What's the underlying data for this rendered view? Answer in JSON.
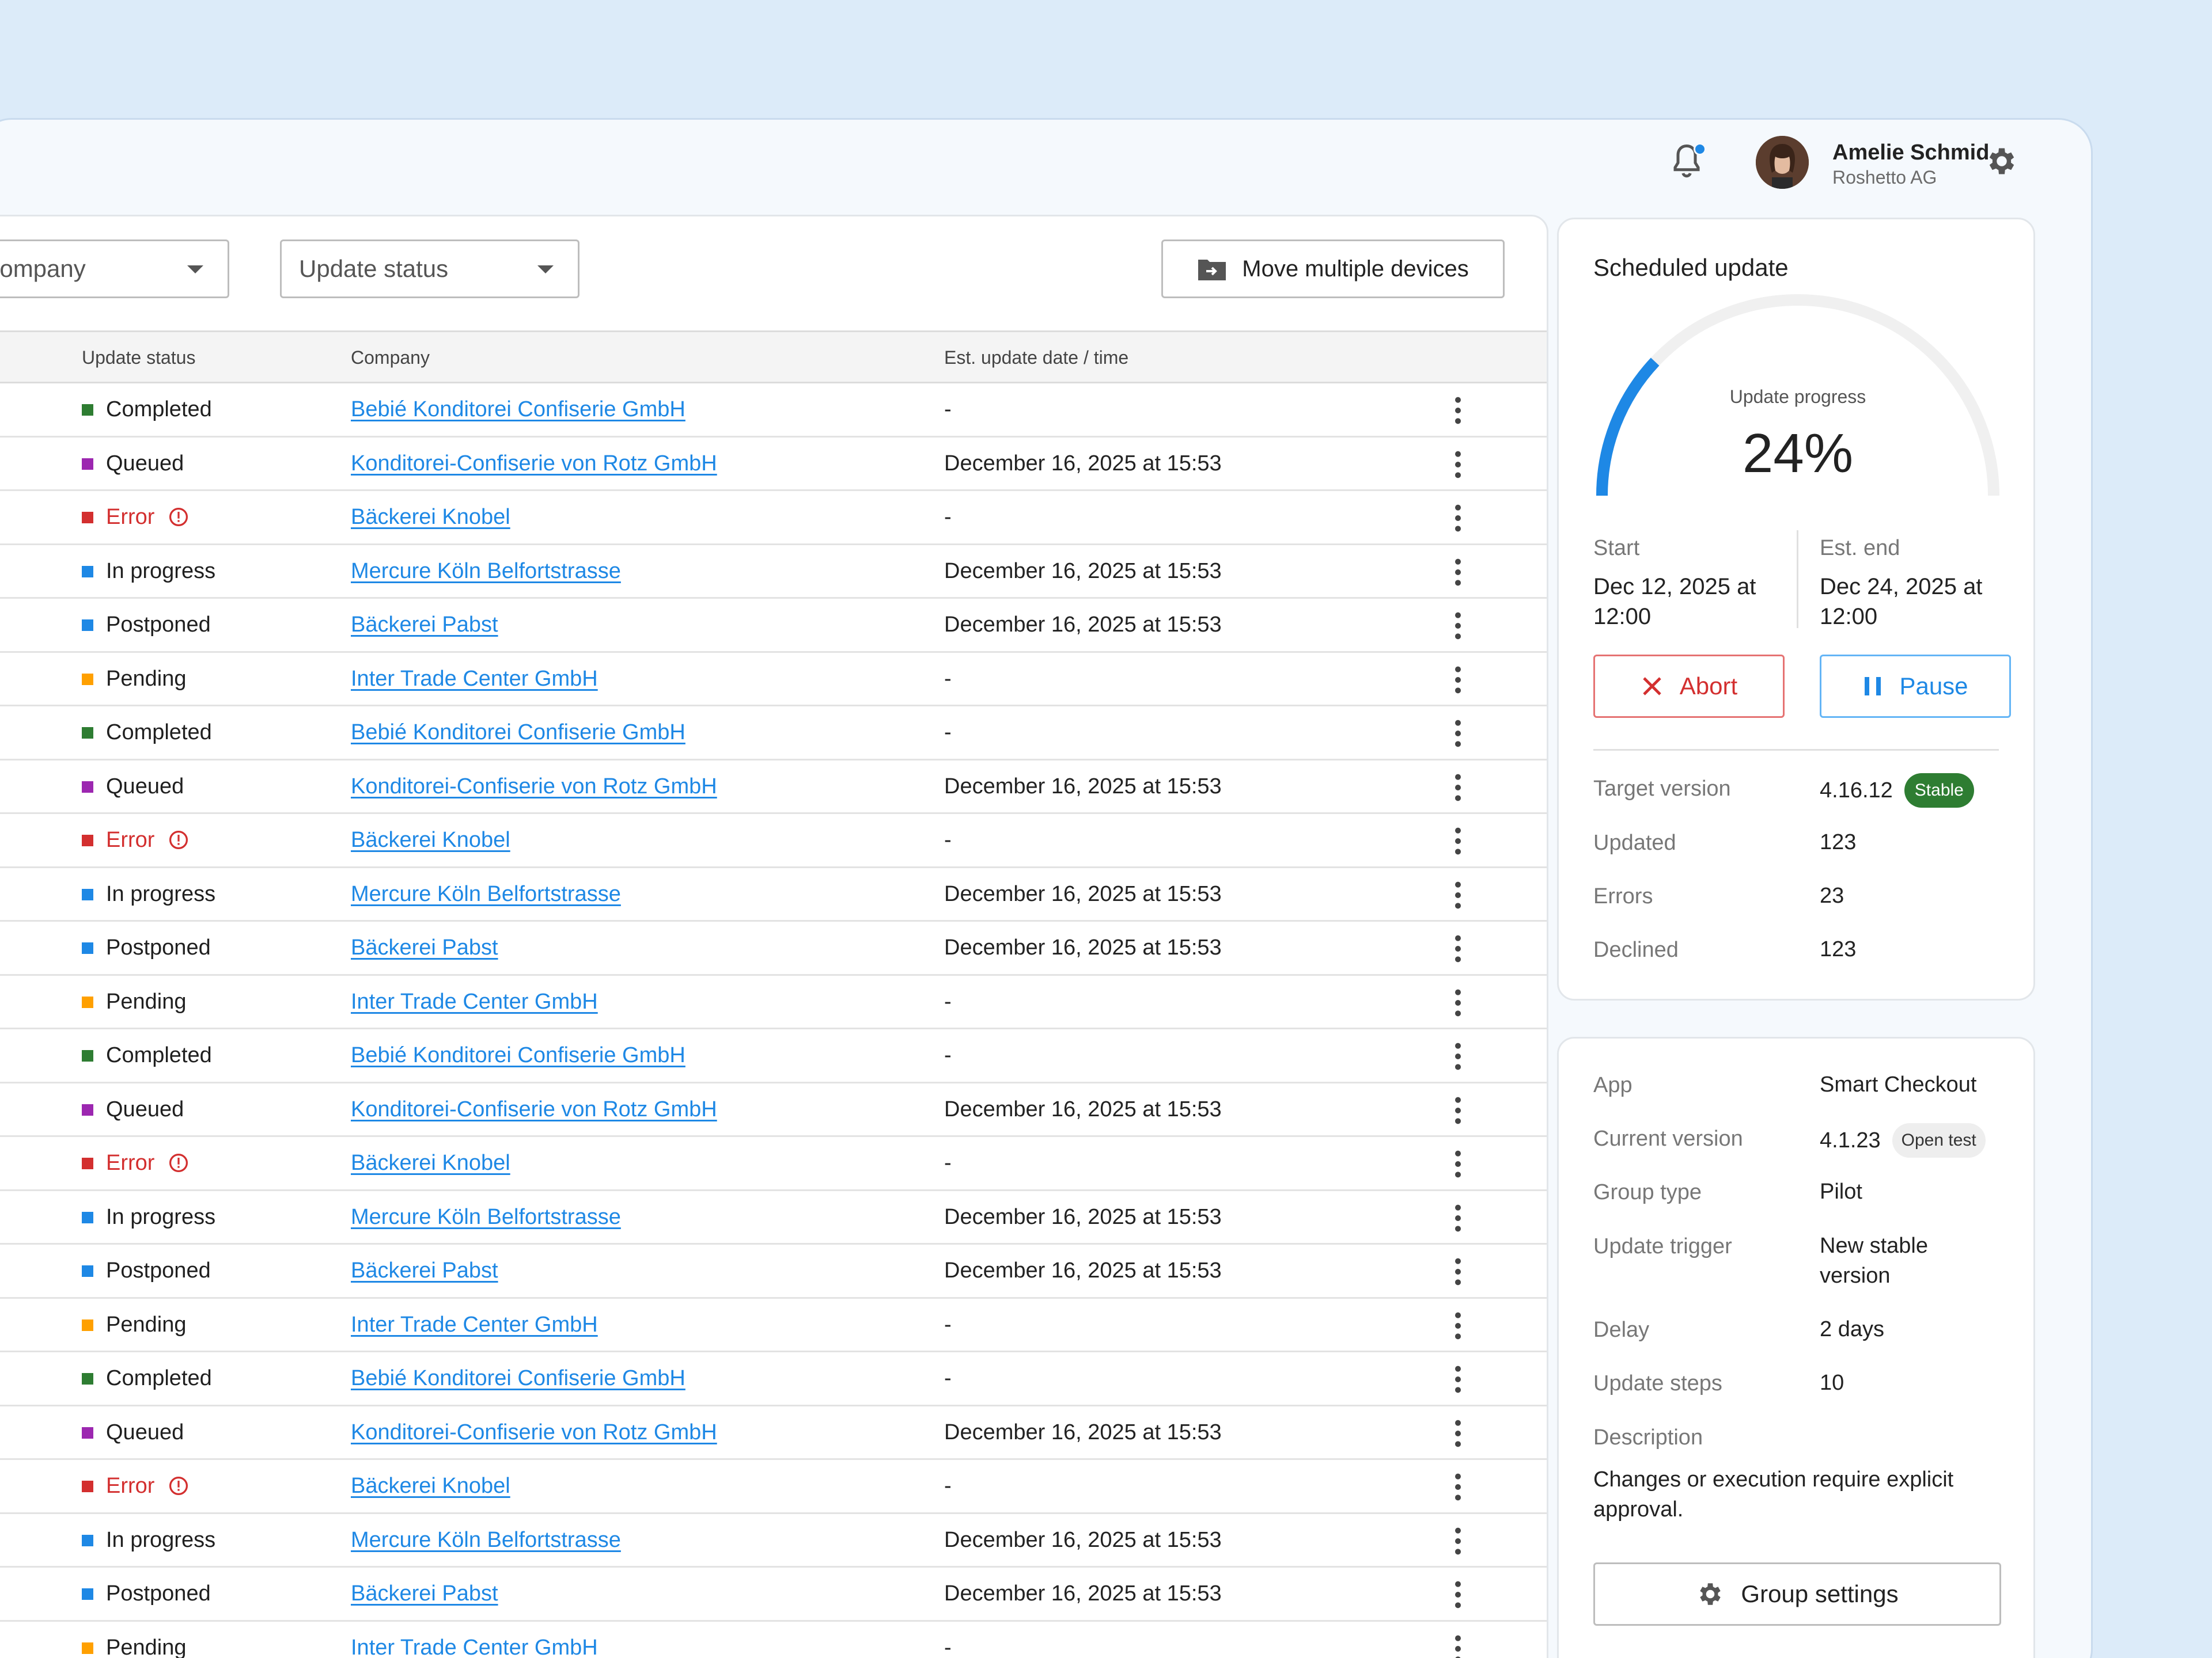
{
  "user": {
    "name": "Amelie Schmid",
    "org": "Roshetto AG"
  },
  "filters": {
    "company": "Company",
    "update_status": "Update status"
  },
  "toolbar": {
    "move_label": "Move multiple devices"
  },
  "table": {
    "headers": {
      "status": "Update status",
      "company": "Company",
      "date": "Est. update date / time"
    },
    "rows": [
      {
        "status": "Completed",
        "company": "Bebié Konditorei Confiserie GmbH",
        "date": "-"
      },
      {
        "status": "Queued",
        "company": "Konditorei-Confiserie von Rotz GmbH",
        "date": "December 16, 2025 at 15:53"
      },
      {
        "status": "Error",
        "company": "Bäckerei Knobel",
        "date": "-"
      },
      {
        "status": "In progress",
        "company": "Mercure Köln Belfortstrasse",
        "date": "December 16, 2025 at 15:53"
      },
      {
        "status": "Postponed",
        "company": "Bäckerei Pabst",
        "date": "December 16, 2025 at 15:53"
      },
      {
        "status": "Pending",
        "company": "Inter Trade Center GmbH",
        "date": "-"
      },
      {
        "status": "Completed",
        "company": "Bebié Konditorei Confiserie GmbH",
        "date": "-"
      },
      {
        "status": "Queued",
        "company": "Konditorei-Confiserie von Rotz GmbH",
        "date": "December 16, 2025 at 15:53"
      },
      {
        "status": "Error",
        "company": "Bäckerei Knobel",
        "date": "-"
      },
      {
        "status": "In progress",
        "company": "Mercure Köln Belfortstrasse",
        "date": "December 16, 2025 at 15:53"
      },
      {
        "status": "Postponed",
        "company": "Bäckerei Pabst",
        "date": "December 16, 2025 at 15:53"
      },
      {
        "status": "Pending",
        "company": "Inter Trade Center GmbH",
        "date": "-"
      },
      {
        "status": "Completed",
        "company": "Bebié Konditorei Confiserie GmbH",
        "date": "-"
      },
      {
        "status": "Queued",
        "company": "Konditorei-Confiserie von Rotz GmbH",
        "date": "December 16, 2025 at 15:53"
      },
      {
        "status": "Error",
        "company": "Bäckerei Knobel",
        "date": "-"
      },
      {
        "status": "In progress",
        "company": "Mercure Köln Belfortstrasse",
        "date": "December 16, 2025 at 15:53"
      },
      {
        "status": "Postponed",
        "company": "Bäckerei Pabst",
        "date": "December 16, 2025 at 15:53"
      },
      {
        "status": "Pending",
        "company": "Inter Trade Center GmbH",
        "date": "-"
      },
      {
        "status": "Completed",
        "company": "Bebié Konditorei Confiserie GmbH",
        "date": "-"
      },
      {
        "status": "Queued",
        "company": "Konditorei-Confiserie von Rotz GmbH",
        "date": "December 16, 2025 at 15:53"
      },
      {
        "status": "Error",
        "company": "Bäckerei Knobel",
        "date": "-"
      },
      {
        "status": "In progress",
        "company": "Mercure Köln Belfortstrasse",
        "date": "December 16, 2025 at 15:53"
      },
      {
        "status": "Postponed",
        "company": "Bäckerei Pabst",
        "date": "December 16, 2025 at 15:53"
      },
      {
        "status": "Pending",
        "company": "Inter Trade Center GmbH",
        "date": "-"
      }
    ]
  },
  "status_colors": {
    "Completed": "#2e7d32",
    "Queued": "#9c27b0",
    "Error": "#d32f2f",
    "In progress": "#1e88e5",
    "Postponed": "#1e88e5",
    "Pending": "#ffa000"
  },
  "scheduled": {
    "title": "Scheduled update",
    "progress_label": "Update progress",
    "progress_value": "24%",
    "progress_fraction": 0.24,
    "start_label": "Start",
    "start_value": "Dec 12, 2025 at 12:00",
    "end_label": "Est. end",
    "end_value": "Dec 24, 2025 at 12:00",
    "abort_label": "Abort",
    "pause_label": "Pause",
    "target_version_label": "Target version",
    "target_version_value": "4.16.12",
    "target_badge": "Stable",
    "updated_label": "Updated",
    "updated_value": "123",
    "errors_label": "Errors",
    "errors_value": "23",
    "declined_label": "Declined",
    "declined_value": "123"
  },
  "details": {
    "app_label": "App",
    "app_value": "Smart Checkout",
    "current_version_label": "Current version",
    "current_version_value": "4.1.23",
    "current_badge": "Open test",
    "group_type_label": "Group type",
    "group_type_value": "Pilot",
    "trigger_label": "Update trigger",
    "trigger_value": "New stable version",
    "delay_label": "Delay",
    "delay_value": "2 days",
    "steps_label": "Update steps",
    "steps_value": "10",
    "description_label": "Description",
    "description_value": "Changes or execution require explicit approval.",
    "group_settings_label": "Group settings"
  },
  "icons": {
    "bell": "bell-icon",
    "settings": "gear-icon",
    "move": "folder-move-icon",
    "error_info": "info-circle-icon",
    "row_menu": "kebab-icon",
    "abort": "close-icon",
    "pause": "pause-icon"
  },
  "colors": {
    "accent": "#1e88e5",
    "error": "#d32f2f",
    "stable": "#2e7d32",
    "gauge_track": "#f0f0f0"
  }
}
